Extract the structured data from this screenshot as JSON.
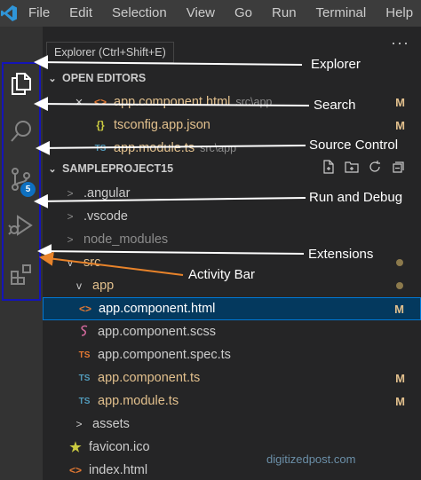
{
  "menubar": {
    "items": [
      "File",
      "Edit",
      "Selection",
      "View",
      "Go",
      "Run",
      "Terminal",
      "Help"
    ]
  },
  "activity_bar": {
    "source_control_badge": "5",
    "icons": [
      "explorer-icon",
      "search-icon",
      "source-control-icon",
      "run-debug-icon",
      "extensions-icon"
    ]
  },
  "tooltip": "Explorer (Ctrl+Shift+E)",
  "more_actions": "···",
  "open_editors": {
    "header": "OPEN EDITORS",
    "items": [
      {
        "close": "×",
        "icon": "<>",
        "name": "app.component.html",
        "desc": "src\\app",
        "status": "M"
      },
      {
        "icon": "{}",
        "name": "tsconfig.app.json",
        "desc": "",
        "status": "M"
      },
      {
        "icon": "TS",
        "name": "app.module.ts",
        "desc": "src\\app",
        "status": ""
      }
    ]
  },
  "project": {
    "header": "SAMPLEPROJECT15",
    "tree": [
      {
        "chevron": ">",
        "name": ".angular"
      },
      {
        "chevron": ">",
        "name": ".vscode"
      },
      {
        "chevron": ">",
        "name": "node_modules"
      },
      {
        "chevron": "v",
        "name": "src"
      },
      {
        "chevron": "v",
        "name": "app"
      },
      {
        "icon": "<>",
        "name": "app.component.html",
        "status": "M"
      },
      {
        "icon": "scss",
        "name": "app.component.scss"
      },
      {
        "icon": "TS",
        "name": "app.component.spec.ts"
      },
      {
        "icon": "TS",
        "name": "app.component.ts",
        "status": "M"
      },
      {
        "icon": "TS",
        "name": "app.module.ts",
        "status": "M"
      },
      {
        "chevron": ">",
        "name": "assets"
      },
      {
        "icon": "star",
        "name": "favicon.ico"
      },
      {
        "icon": "<>",
        "name": "index.html"
      }
    ]
  },
  "annotations": {
    "explorer": "Explorer",
    "search": "Search",
    "source_control": "Source Control",
    "run_debug": "Run and Debug",
    "extensions": "Extensions",
    "activity_bar": "Activity Bar"
  },
  "watermark": "digitizedpost.com",
  "colors": {
    "accent_blue": "#0078d4",
    "html_icon": "#e37933",
    "ts_icon": "#519aba",
    "json_icon": "#cbcb41",
    "modified": "#e2c08d",
    "arrow_orange": "#e8832a",
    "highlight_border": "#1414b8"
  }
}
